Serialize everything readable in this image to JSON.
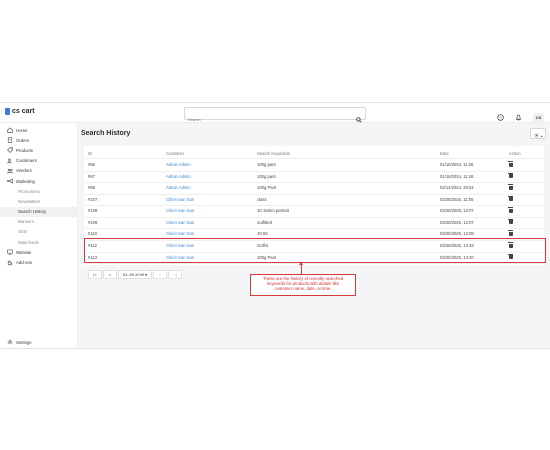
{
  "app": {
    "logo_text": "cs cart",
    "accent": "#3f7ad8",
    "annotation_color": "#d63b3b"
  },
  "search": {
    "placeholder": "Search",
    "value": ""
  },
  "topbar": {
    "avatar": "CS",
    "help_icon": "help-circle-icon",
    "bell_icon": "bell-icon"
  },
  "sidebar": {
    "items": [
      {
        "label": "Home",
        "icon": "home-icon"
      },
      {
        "label": "Orders",
        "icon": "orders-icon"
      },
      {
        "label": "Products",
        "icon": "tag-icon"
      },
      {
        "label": "Customers",
        "icon": "users-icon"
      },
      {
        "label": "Vendors",
        "icon": "vendor-icon"
      },
      {
        "label": "Marketing",
        "icon": "megaphone-icon"
      },
      {
        "label": "Promotions"
      },
      {
        "label": "Newsletters"
      },
      {
        "label": "Search History",
        "active": true
      },
      {
        "label": "Banners"
      },
      {
        "label": "SEO"
      },
      {
        "label": "Data feeds"
      },
      {
        "label": "Website",
        "icon": "monitor-icon"
      },
      {
        "label": "Add-ons",
        "icon": "puzzle-icon"
      }
    ],
    "settings_label": "Settings"
  },
  "main": {
    "title": "Search History"
  },
  "table": {
    "headers": {
      "id": "ID",
      "customer": "Customer",
      "keywords": "Search Keywords",
      "date": "Date",
      "action": "Action"
    },
    "rows": [
      {
        "id": "#66",
        "customer": "Admin Admin",
        "keywords": "100g pant",
        "date": "01/15/2024, 11:26"
      },
      {
        "id": "#67",
        "customer": "Admin Admin",
        "keywords": "100g pant",
        "date": "01/15/2024, 11:26"
      },
      {
        "id": "#68",
        "customer": "Admin Admin",
        "keywords": "100g Pant",
        "date": "02/14/2024, 20:51"
      },
      {
        "id": "#107",
        "customer": "Chien San San",
        "keywords": "class",
        "date": "03/25/2025, 11:05"
      },
      {
        "id": "#108",
        "customer": "Chien San San",
        "keywords": "10-15mm portrait",
        "date": "03/25/2025, 12:07"
      },
      {
        "id": "#109",
        "customer": "Chien San San",
        "keywords": "outfitted",
        "date": "03/25/2025, 12:07"
      },
      {
        "id": "#110",
        "customer": "Chien San San",
        "keywords": "10-55",
        "date": "03/25/2025, 12:08"
      },
      {
        "id": "#112",
        "customer": "Chien San San",
        "keywords": "Golfrs",
        "date": "03/25/2025, 13:33"
      },
      {
        "id": "#113",
        "customer": "Chien San San",
        "keywords": "100g Pant",
        "date": "03/25/2025, 13:40"
      }
    ]
  },
  "pagination": {
    "summary": "51–59 of 59 ▾",
    "first": "|<",
    "prev": "<",
    "next": ">",
    "last": ">|"
  },
  "annotation": {
    "line1": "These are the history of recently searched",
    "line2": "keywords for products with details like",
    "line3": "customer name, date, or time."
  }
}
